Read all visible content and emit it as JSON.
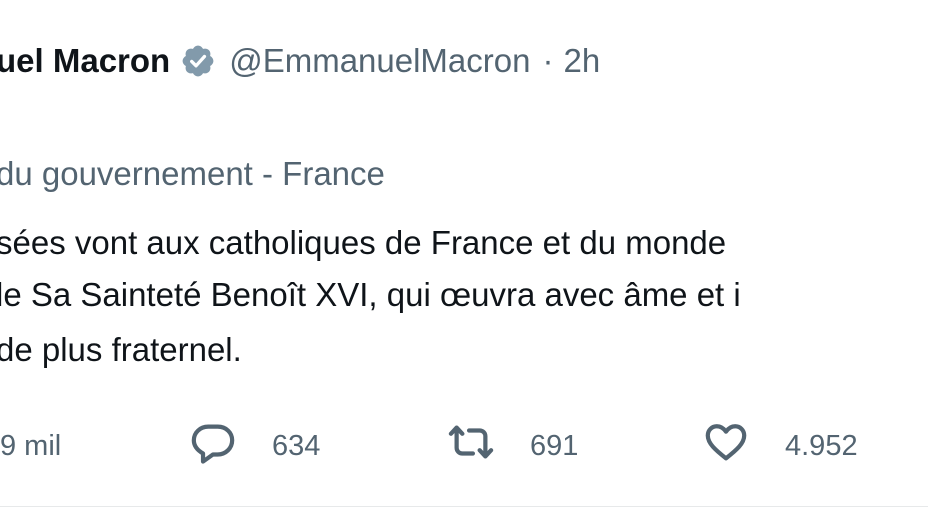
{
  "tweet": {
    "author_name": "uel Macron",
    "verified_icon": "verified-badge-icon",
    "handle": "@EmmanuelMacron",
    "separator": "·",
    "time": "2h",
    "label": "du gouvernement - France",
    "lines": [
      "sées vont aux catholiques de France et du monde",
      "le Sa Sainteté Benoît XVI, qui œuvra avec âme et i",
      "de plus fraternel."
    ]
  },
  "actions": {
    "views": "9 mil",
    "replies": "634",
    "retweets": "691",
    "likes": "4.952",
    "reply_icon": "reply-icon",
    "retweet_icon": "retweet-icon",
    "like_icon": "heart-icon"
  },
  "colors": {
    "text": "#0f1419",
    "secondary": "#536471",
    "verified": "#829aab",
    "divider": "#e7e9ea"
  }
}
